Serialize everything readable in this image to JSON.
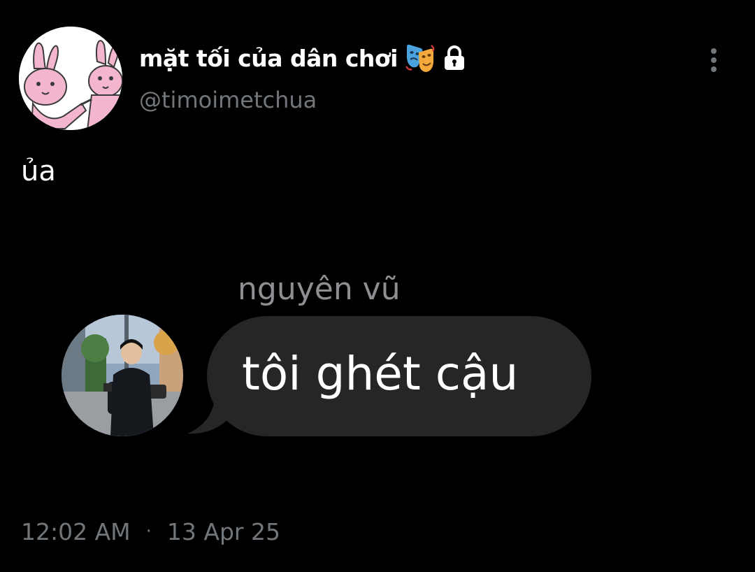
{
  "tweet": {
    "author": {
      "display_name": "mặt tối của dân chơi",
      "handle": "@timoimetchua",
      "name_emoji": "performing-arts-emoji",
      "protected_icon": "lock-icon",
      "avatar": "pink-bunnies-avatar"
    },
    "menu_icon": "more-vertical-icon",
    "text": "ủa",
    "media": {
      "type": "chat-message-screenshot",
      "sender_name": "nguyên vũ",
      "sender_avatar": "person-on-street-avatar",
      "message": "tôi ghét cậu"
    },
    "timestamp": {
      "time": "12:02 AM",
      "separator": "·",
      "date": "13 Apr 25"
    }
  },
  "colors": {
    "background": "#000000",
    "text_primary": "#ffffff",
    "text_secondary": "#71767b",
    "bubble": "#262628",
    "sender_name": "#8e8e93",
    "avatar_pink": "#f4b6cf"
  }
}
